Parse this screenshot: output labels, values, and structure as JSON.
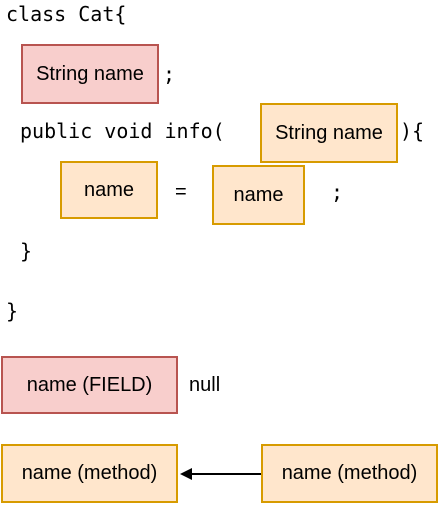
{
  "code": {
    "line1": "class Cat{",
    "semicolon1": ";",
    "line3_prefix": "public void info(",
    "line3_suffix": "){",
    "equals": "=",
    "semicolon2": ";",
    "close_inner": "}",
    "close_outer": "}"
  },
  "boxes": {
    "field_decl": "String name",
    "param_decl": "String name",
    "assign_left": "name",
    "assign_right": "name",
    "field_label": "name (FIELD)",
    "method_left": "name (method)",
    "method_right": "name (method)"
  },
  "field_value": "null",
  "colors": {
    "red_fill": "#f8cecc",
    "red_border": "#b85450",
    "orange_fill": "#ffe6cc",
    "orange_border": "#d79b00",
    "arrow": "#000000"
  }
}
